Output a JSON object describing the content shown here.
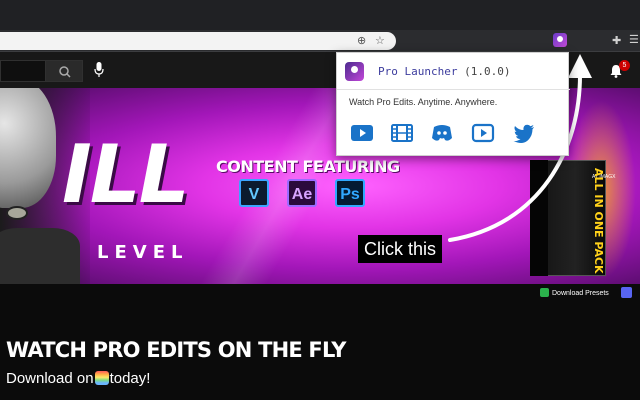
{
  "browser": {
    "extension_name": "Pro Launcher",
    "extension_version": "(1.0.0)",
    "icons": [
      "account-icon",
      "star-icon",
      "extension-icon",
      "puzzle-icon",
      "menu-icon"
    ]
  },
  "site": {
    "notification_count": "5"
  },
  "popup": {
    "title": "Pro Launcher",
    "version": "(1.0.0)",
    "tagline": "Watch Pro Edits. Anytime. Anywhere.",
    "links": [
      {
        "name": "youtube-icon",
        "color": "#1a73c8"
      },
      {
        "name": "film-icon",
        "color": "#1a73c8"
      },
      {
        "name": "discord-icon",
        "color": "#1a73c8"
      },
      {
        "name": "youtube-outline-icon",
        "color": "#1a73c8"
      },
      {
        "name": "twitter-icon",
        "color": "#1a73c8"
      }
    ]
  },
  "banner": {
    "big_text": "ILL",
    "level_text": "LEVEL",
    "content_featuring": "CONTENT FEATURING",
    "tiles": [
      "V",
      "Ae",
      "Ps"
    ],
    "callout": "Click this",
    "product_tag": "AT IMAGX",
    "product_title": "ALL IN ONE PACK",
    "download_presets": "Download Presets"
  },
  "main": {
    "headline": "WATCH PRO EDITS ON THE FLY",
    "download_prefix": "Download on",
    "download_suffix": "today!"
  },
  "colors": {
    "accent_pink": "#e234e6",
    "popup_title": "#3d3d9e",
    "popup_icons": "#1a73c8",
    "badge": "#cc0000"
  }
}
